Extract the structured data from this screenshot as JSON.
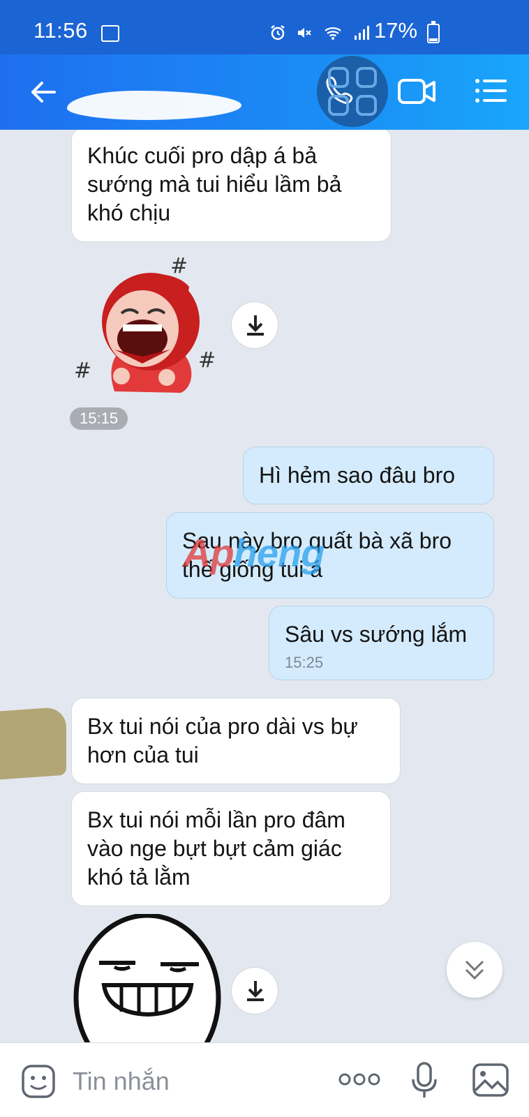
{
  "status_bar": {
    "time": "11:56",
    "battery": "17%",
    "battery_level": 0.17,
    "icons": [
      "image-icon",
      "alarm-icon",
      "mute-icon",
      "wifi-icon",
      "signal-icon",
      "battery-icon"
    ]
  },
  "header": {
    "icons": [
      "back-arrow-icon",
      "phone-call-icon",
      "video-call-icon",
      "menu-list-icon"
    ]
  },
  "messages": [
    {
      "side": "in",
      "text": "Khúc cuối pro dập á bả sướng mà tui hiểu lầm bả khó chịu"
    },
    {
      "side": "in",
      "type": "sticker",
      "desc_icon": "laughing-girl-sticker"
    },
    {
      "side": "in",
      "type": "time",
      "text": "15:15"
    },
    {
      "side": "out",
      "text": "Hì hẻm sao đâu bro"
    },
    {
      "side": "out",
      "text": "Sau này bro quất bà xã bro thế giống tui á"
    },
    {
      "side": "out",
      "text": "Sâu vs sướng lắm",
      "time": "15:25"
    },
    {
      "side": "in",
      "text": "Bx tui nói của pro dài vs bự hơn của tui"
    },
    {
      "side": "in",
      "text": "Bx tui nói mỗi lần pro đâm vào nge bựt bựt cảm giác khó tả lằm"
    },
    {
      "side": "in",
      "type": "sticker",
      "desc_icon": "grinning-face-sticker"
    }
  ],
  "watermark": {
    "part1": "Ap",
    "part2": "heng"
  },
  "input": {
    "placeholder": "Tin nhắn",
    "icons": [
      "sticker-icon",
      "more-icon",
      "microphone-icon",
      "gallery-icon"
    ]
  },
  "colors": {
    "header": "#1e6ff0",
    "outgoing": "#d4ebfd",
    "incoming": "#ffffff",
    "background": "#e3e8f0"
  }
}
